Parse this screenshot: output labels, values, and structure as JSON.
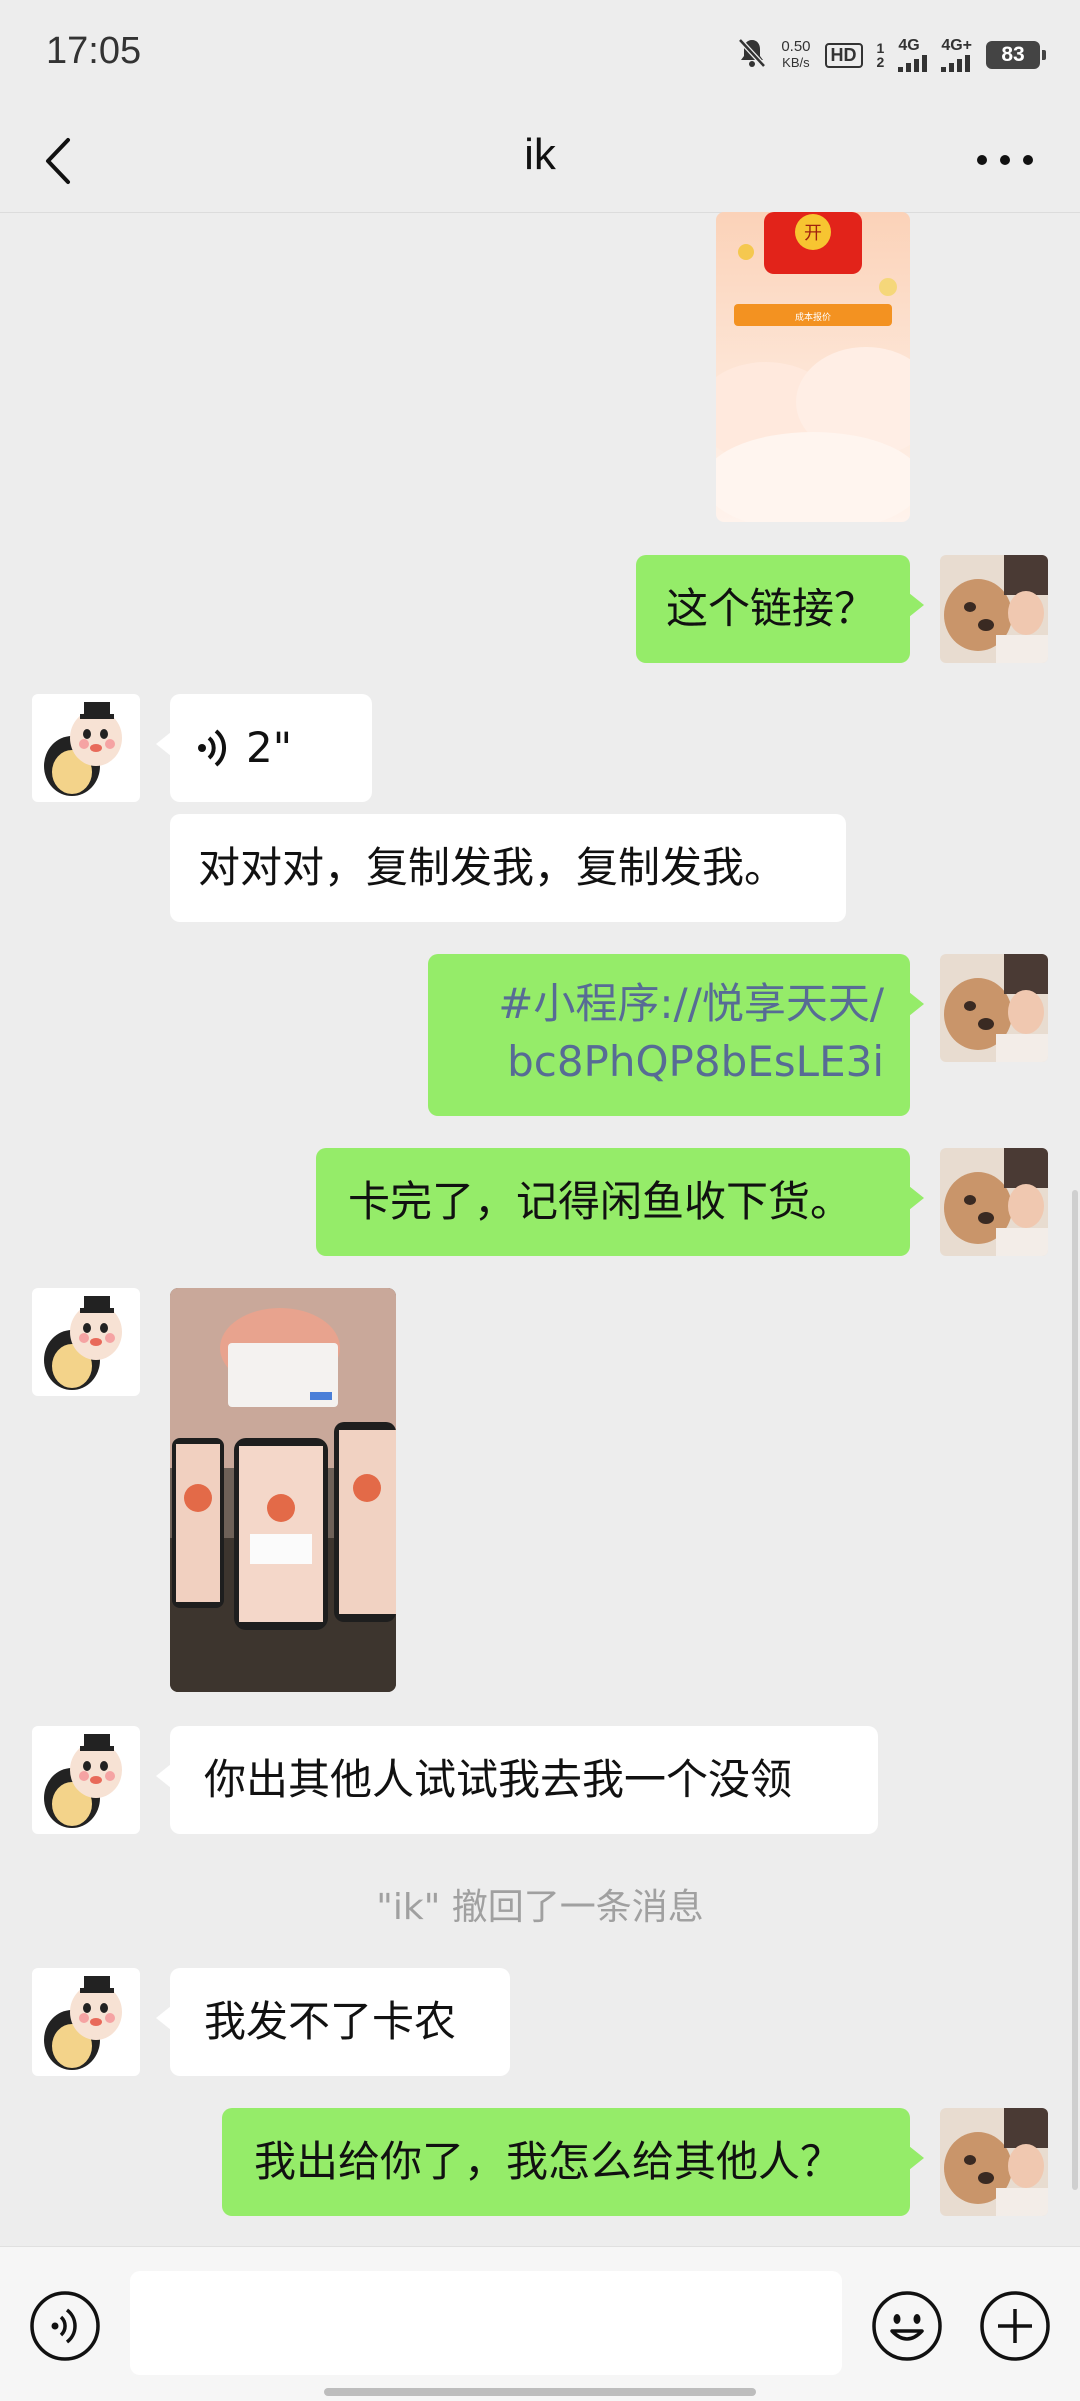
{
  "status_bar": {
    "time": "17:05",
    "net_speed_value": "0.50",
    "net_speed_unit": "KB/s",
    "hd_label": "HD",
    "sim_superscript": "1",
    "sim_subscript": "2",
    "sim1_network": "4G",
    "sim2_network": "4G+",
    "battery": "83",
    "icons": [
      "mute-bell-icon",
      "signal-icon",
      "battery-icon"
    ]
  },
  "header": {
    "title": "ik",
    "icons": [
      "back-chevron-icon",
      "more-dots-icon"
    ]
  },
  "messages": [
    {
      "sender": "ik",
      "type": "image",
      "content": "red-packet-screenshot",
      "image_text": [
        "开",
        "成本报价"
      ]
    },
    {
      "sender": "me",
      "type": "text",
      "text": "这个链接？"
    },
    {
      "sender": "ik",
      "type": "voice",
      "duration": "2\""
    },
    {
      "sender": "ik",
      "type": "text",
      "text": "对对对，复制发我，复制发我。"
    },
    {
      "sender": "me",
      "type": "text",
      "text_line1": "#小程序://悦享天天/",
      "text_line2": "bc8PhQP8bEsLE3i"
    },
    {
      "sender": "me",
      "type": "text",
      "text": "卡完了，记得闲鱼收下货。"
    },
    {
      "sender": "ik",
      "type": "image",
      "content": "photo-of-three-phones"
    },
    {
      "sender": "ik",
      "type": "text",
      "text": "你出其他人试试我去我一个没领"
    },
    {
      "sender": "system",
      "type": "notice",
      "text": "\"ik\" 撤回了一条消息"
    },
    {
      "sender": "ik",
      "type": "text",
      "text": "我发不了卡农"
    },
    {
      "sender": "me",
      "type": "text",
      "text": "我出给你了，我怎么给其他人？"
    }
  ],
  "input_bar": {
    "value": "",
    "placeholder": "",
    "icons": [
      "voice-input-icon",
      "emoji-icon",
      "plus-icon"
    ]
  },
  "colors": {
    "background": "#ededed",
    "my_bubble": "#95ec69",
    "other_bubble": "#ffffff",
    "link_text": "#576b95",
    "system_text": "#a0a0a0"
  }
}
